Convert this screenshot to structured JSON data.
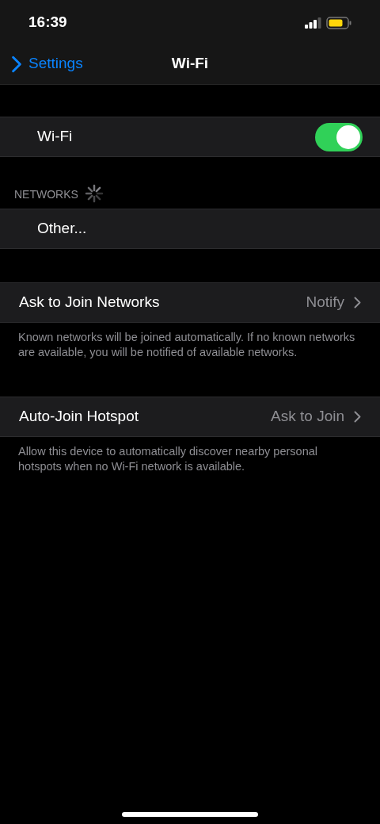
{
  "status_bar": {
    "time": "16:39"
  },
  "nav": {
    "back": "Settings",
    "title": "Wi-Fi"
  },
  "wifi": {
    "label": "Wi-Fi",
    "on": true
  },
  "networks": {
    "header": "NETWORKS",
    "items": [
      {
        "label": "Other..."
      }
    ]
  },
  "options": [
    {
      "label": "Ask to Join Networks",
      "value": "Notify",
      "footer": "Known networks will be joined automatically. If no known networks are available, you will be notified of available networks."
    },
    {
      "label": "Auto-Join Hotspot",
      "value": "Ask to Join",
      "footer": "Allow this device to automatically discover nearby personal hotspots when no Wi-Fi network is available."
    }
  ]
}
